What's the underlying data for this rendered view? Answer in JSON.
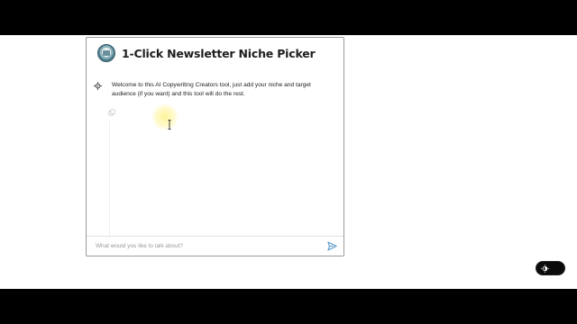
{
  "chat": {
    "title": "1-Click Newsletter Niche Picker",
    "logo_icon": "newsletter-logo-icon",
    "messages": [
      {
        "role": "assistant",
        "icon": "bot-icon",
        "text": "Welcome to this AI Copywriting Creators tool, just add your niche and target audience (if you want) and this tool will do the rest."
      }
    ],
    "copy_icon": "copy-icon"
  },
  "composer": {
    "placeholder": "What would you like to talk about?",
    "value": "",
    "send_icon": "send-icon"
  },
  "theme_toggle": {
    "icon": "half-sun-icon"
  },
  "colors": {
    "accent": "#4a90c8",
    "frame": "#000000",
    "page": "#ffffff",
    "text": "#1e1e1e",
    "placeholder": "#9a9a9a",
    "cursor_highlight": "#fff078"
  }
}
